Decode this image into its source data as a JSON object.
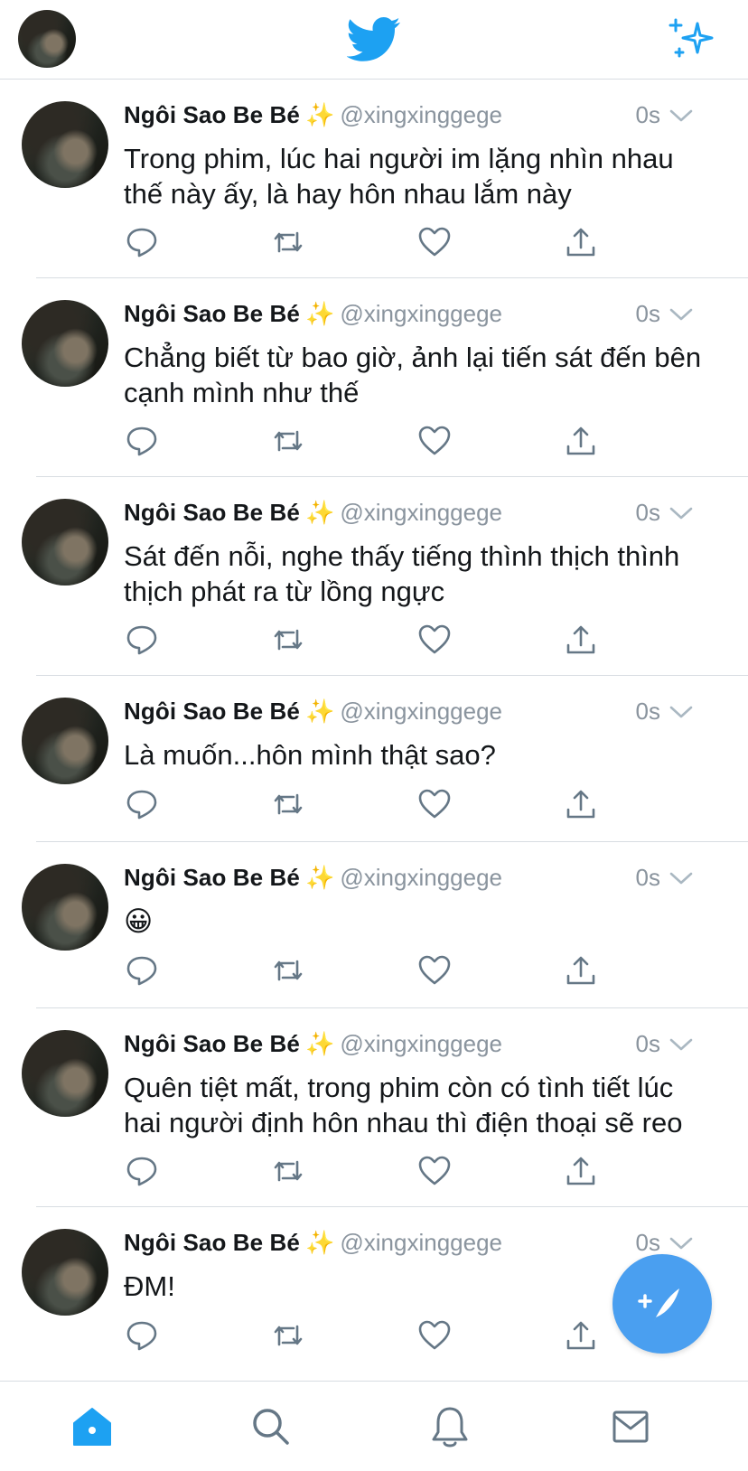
{
  "header": {
    "avatar_icon": "profile-avatar",
    "logo_icon": "twitter-bird-icon",
    "sparkle_icon": "sparkle-icon",
    "brand_color": "#1da1f2"
  },
  "tweets": [
    {
      "name": "Ngôi Sao Be Bé",
      "emoji": "✨",
      "handle": "@xingxinggege",
      "time": "0s",
      "text": "Trong phim, lúc hai người im lặng nhìn nhau thế này ấy, là hay hôn nhau lắm này"
    },
    {
      "name": "Ngôi Sao Be Bé",
      "emoji": "✨",
      "handle": "@xingxinggege",
      "time": "0s",
      "text": "Chẳng biết từ bao giờ, ảnh lại tiến sát đến bên cạnh mình như thế"
    },
    {
      "name": "Ngôi Sao Be Bé",
      "emoji": "✨",
      "handle": "@xingxinggege",
      "time": "0s",
      "text": "Sát đến nỗi, nghe thấy tiếng thình thịch thình thịch phát ra từ lồng ngực"
    },
    {
      "name": "Ngôi Sao Be Bé",
      "emoji": "✨",
      "handle": "@xingxinggege",
      "time": "0s",
      "text": "Là muốn...hôn mình thật sao?"
    },
    {
      "name": "Ngôi Sao Be Bé",
      "emoji": "✨",
      "handle": "@xingxinggege",
      "time": "0s",
      "text": "😀"
    },
    {
      "name": "Ngôi Sao Be Bé",
      "emoji": "✨",
      "handle": "@xingxinggege",
      "time": "0s",
      "text": "Quên tiệt mất, trong phim còn có tình tiết lúc hai người định hôn nhau thì điện thoại sẽ reo"
    },
    {
      "name": "Ngôi Sao Be Bé",
      "emoji": "✨",
      "handle": "@xingxinggege",
      "time": "0s",
      "text": "ĐM!"
    }
  ],
  "action_icons": [
    "reply-icon",
    "retweet-icon",
    "like-icon",
    "share-icon"
  ],
  "fab": {
    "icon": "compose-tweet-icon",
    "color": "#4a9ff0"
  },
  "tabbar": {
    "items": [
      "home-icon",
      "search-icon",
      "notifications-icon",
      "messages-icon"
    ],
    "active": "home-icon"
  }
}
